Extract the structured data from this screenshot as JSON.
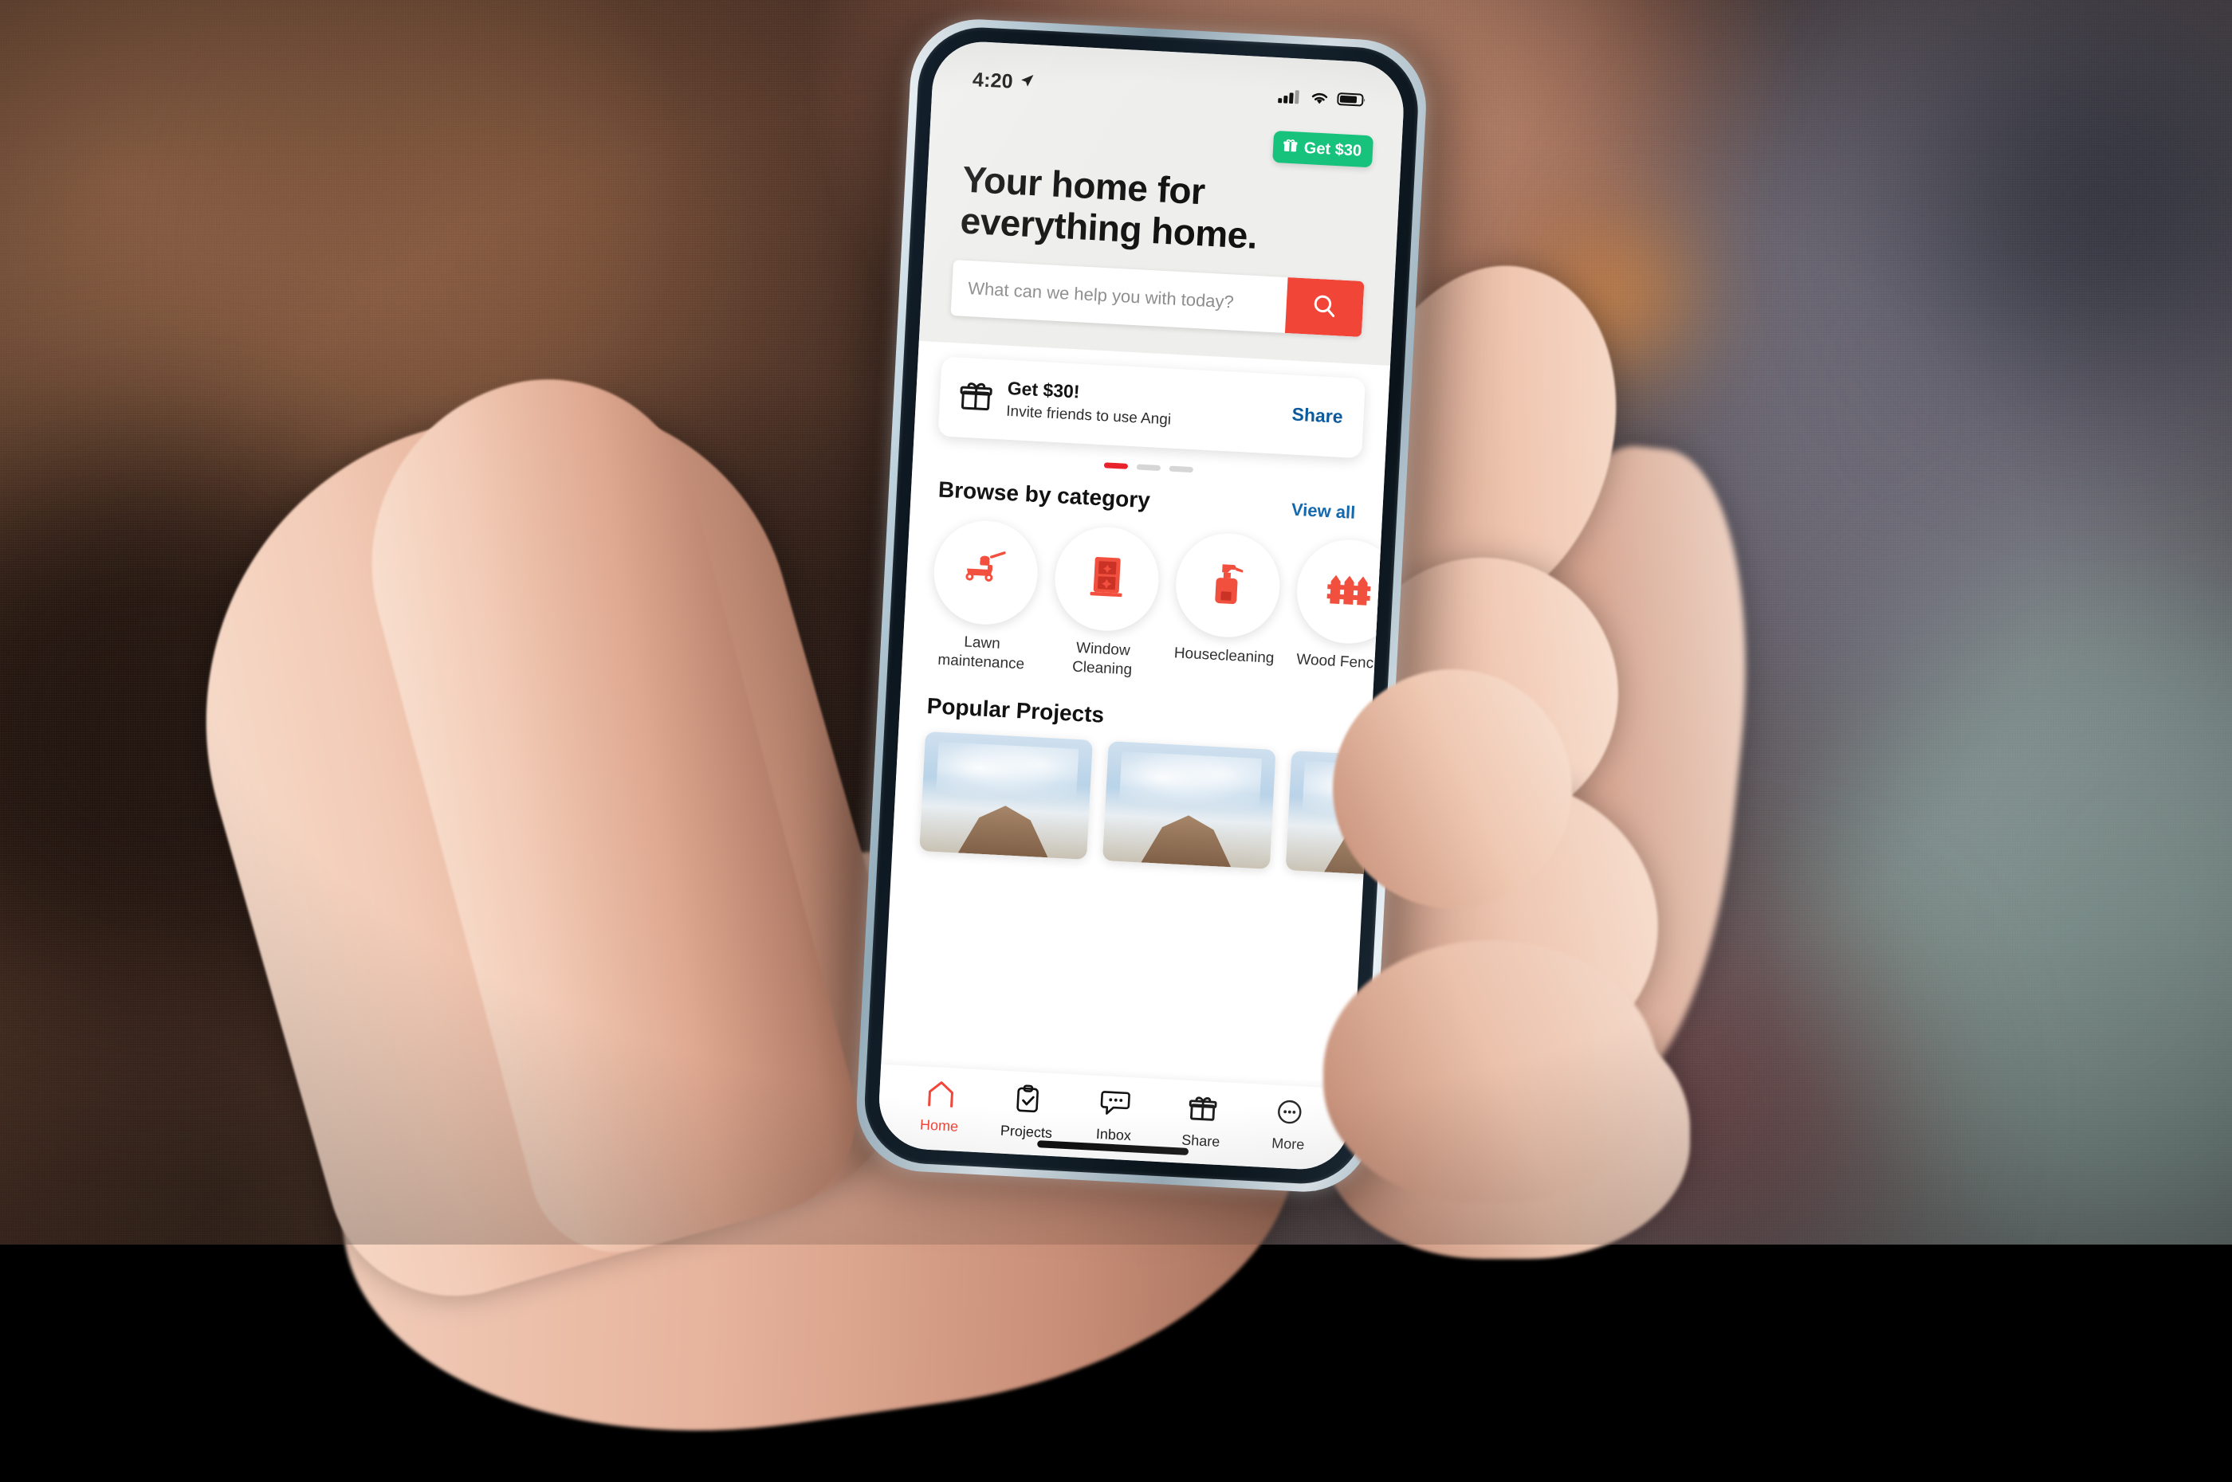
{
  "status_bar": {
    "time": "4:20",
    "location_icon": "location-arrow-icon",
    "cellular_icon": "cellular-signal-icon",
    "wifi_icon": "wifi-icon",
    "battery_icon": "battery-icon"
  },
  "promo_pill": {
    "label": "Get $30",
    "icon": "gift-icon",
    "color": "#16c27c"
  },
  "headline": {
    "line1": "Your home for",
    "line2": "everything home."
  },
  "search": {
    "placeholder": "What can we help you with today?",
    "value": "",
    "button_icon": "search-icon",
    "button_color": "#f14537"
  },
  "referral_card": {
    "icon": "gift-icon",
    "title": "Get $30!",
    "subtitle": "Invite friends to use Angi",
    "action_label": "Share",
    "action_color": "#0c5a9e"
  },
  "carousel_dots": {
    "count": 3,
    "active_index": 0,
    "active_color": "#e8232a",
    "inactive_color": "#d6d6d6"
  },
  "categories_section": {
    "title": "Browse by category",
    "view_all_label": "View all",
    "view_all_color": "#1668ad",
    "items": [
      {
        "label": "Lawn maintenance",
        "icon": "lawn-mower-icon"
      },
      {
        "label": "Window Cleaning",
        "icon": "window-icon"
      },
      {
        "label": "Housecleaning",
        "icon": "spray-bottle-icon"
      },
      {
        "label": "Wood Fencing",
        "icon": "fence-icon"
      }
    ]
  },
  "popular_projects": {
    "title": "Popular Projects",
    "cards": [
      {
        "alt": "roof project photo"
      },
      {
        "alt": "roof project photo"
      },
      {
        "alt": "roof project photo"
      }
    ]
  },
  "tab_bar": {
    "active_color": "#f2463a",
    "items": [
      {
        "label": "Home",
        "icon": "home-icon",
        "active": true
      },
      {
        "label": "Projects",
        "icon": "clipboard-check-icon",
        "active": false
      },
      {
        "label": "Inbox",
        "icon": "chat-bubble-icon",
        "active": false
      },
      {
        "label": "Share",
        "icon": "gift-icon",
        "active": false
      },
      {
        "label": "More",
        "icon": "ellipsis-circle-icon",
        "active": false
      }
    ]
  }
}
